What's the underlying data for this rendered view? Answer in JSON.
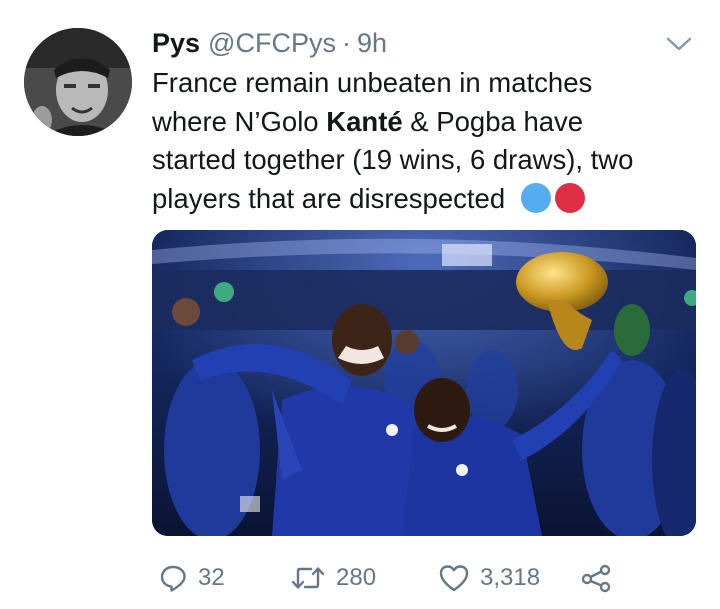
{
  "tweet": {
    "display_name": "Pys",
    "handle": "@CFCPys",
    "separator": "·",
    "time": "9h",
    "text": {
      "line1": "France remain unbeaten in matches",
      "line2_pre": "where N’Golo ",
      "line2_bold": "Kanté",
      "line2_post": " & Pogba have",
      "line3": "started together (19 wins, 6 draws), two",
      "line4": "players that are disrespected "
    },
    "emoji_colors": [
      "#55acee",
      "#dd2e44"
    ],
    "media_alt": ""
  },
  "actions": {
    "replies": "32",
    "retweets": "280",
    "likes": "3,318"
  },
  "colors": {
    "text": "#14171a",
    "secondary": "#657786",
    "france_blue": "#1c2c7a"
  },
  "icons": [
    "chevron-down-icon",
    "reply-icon",
    "retweet-icon",
    "like-icon",
    "share-icon"
  ]
}
